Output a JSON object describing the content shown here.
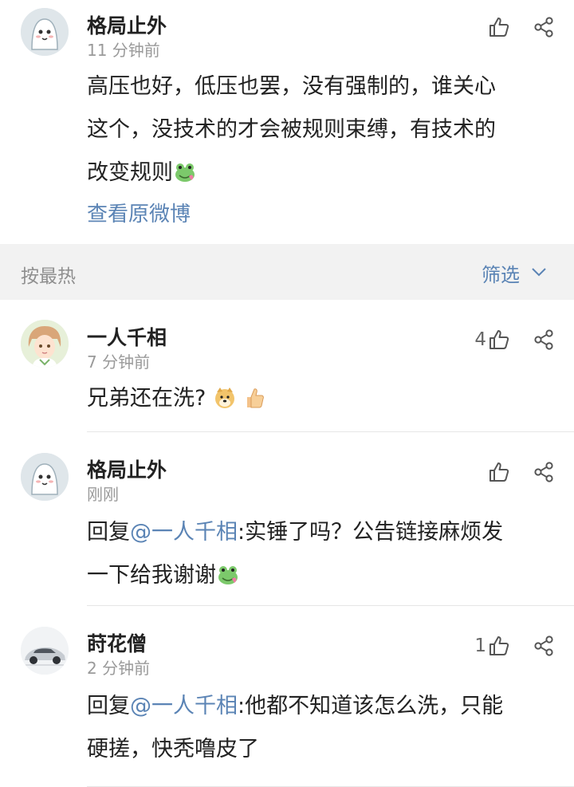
{
  "post": {
    "username": "格局止外",
    "time": "11 分钟前",
    "lines": [
      "高压也好，低压也罢，没有强制的，谁关心",
      "这个，没技术的才会被规则束缚，有技术的",
      "改变规则"
    ],
    "view_original": "查看原微博"
  },
  "sort_bar": {
    "sort_label": "按最热",
    "filter_label": "筛选"
  },
  "comments": [
    {
      "username": "一人千相",
      "time": "7 分钟前",
      "likes": "4",
      "text": "兄弟还在洗?"
    },
    {
      "username": "格局止外",
      "time": "刚刚",
      "likes": "",
      "reply_prefix": "回复",
      "mention": "@一人千相",
      "line1": ":实锤了吗？公告链接麻烦发",
      "line2": "一下给我谢谢"
    },
    {
      "username": "莳花僧",
      "time": "2 分钟前",
      "likes": "1",
      "reply_prefix": "回复",
      "mention": "@一人千相",
      "line1": ":他都不知道该怎么洗，只能",
      "line2": "硬搓，快秃噜皮了"
    }
  ],
  "colors": {
    "link": "#5b84b5",
    "background": "#f2f2f2",
    "card": "#ffffff",
    "muted": "#9a9a9a"
  },
  "icons": [
    "thumbs-up-icon",
    "share-icon",
    "chevron-down-icon",
    "frog-emoji-icon",
    "doge-emoji-icon",
    "thumbs-up-emoji-icon"
  ]
}
